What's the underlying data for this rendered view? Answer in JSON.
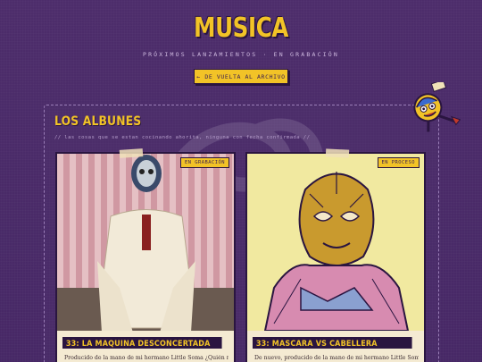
{
  "header": {
    "title": "MUSICA",
    "subtitle": "PRÓXIMOS LANZAMIENTOS · EN GRABACIÓN",
    "back_button": "← DE VUELTA AL ARCHIVO"
  },
  "section": {
    "title": "LOS ALBUNES",
    "note": "// las cosas que se estan cocinando ahorita, ninguna con fecha confirmada //"
  },
  "albums": [
    {
      "badge": "EN GRABACIÓN",
      "title": "33: LA MAQUINA DESCONCERTADA",
      "description": "Producido de la mano de mi hermano Little Soma ¿Quién no"
    },
    {
      "badge": "EN PROCESO",
      "title": "33: MASCARA VS CABELLERA",
      "description": "De nuevo, producido de la mano de mi hermano Little Soma."
    }
  ],
  "colors": {
    "background": "#4a2a66",
    "accent": "#f2c327",
    "dark": "#2a1540",
    "card": "#f4ead2"
  }
}
